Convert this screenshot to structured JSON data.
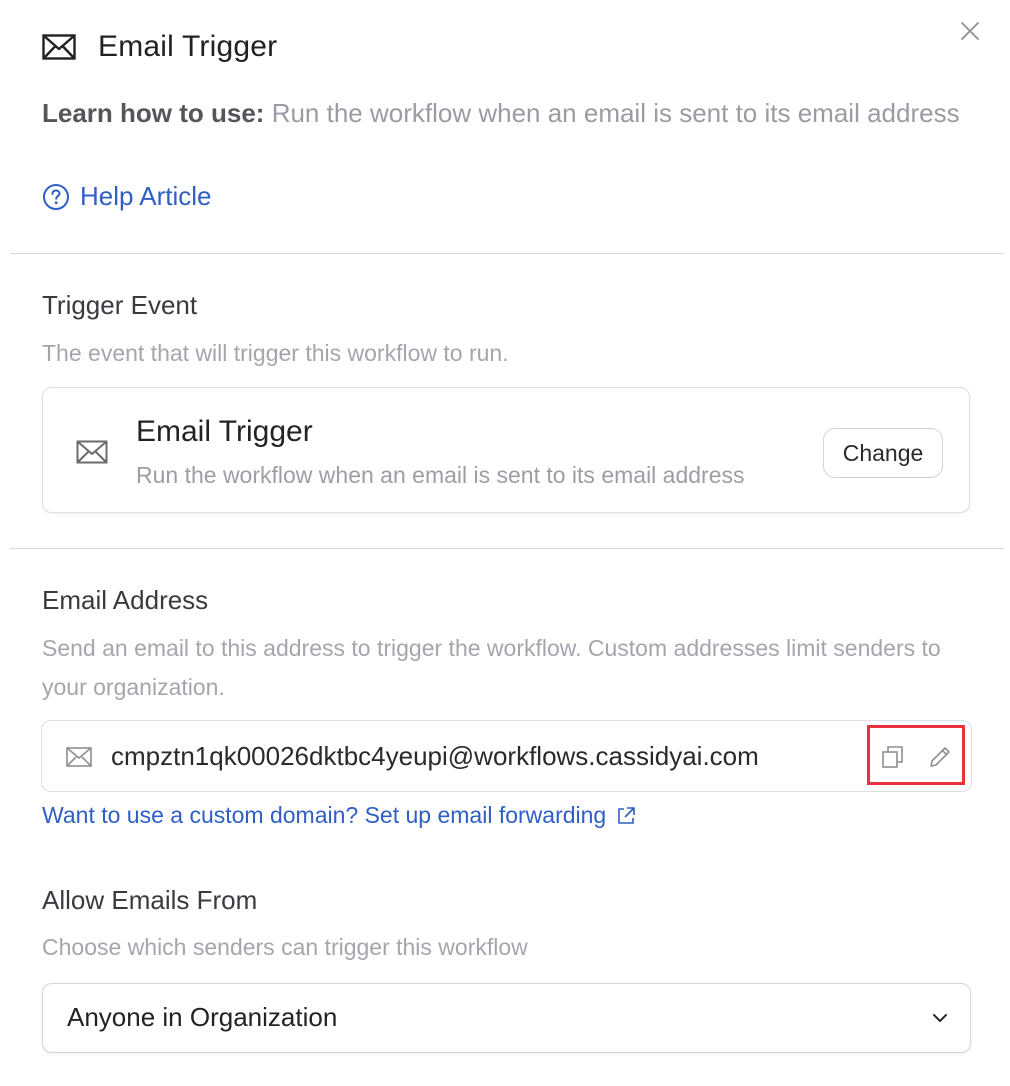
{
  "header": {
    "title": "Email Trigger",
    "icon": "envelope-icon",
    "close_icon": "close-icon"
  },
  "learn": {
    "label": "Learn how to use:",
    "text": " Run the workflow when an email is sent to its email address"
  },
  "help_link": {
    "label": "Help Article",
    "icon": "question-circle-icon"
  },
  "trigger_event": {
    "title": "Trigger Event",
    "description": "The event that will trigger this workflow to run.",
    "card": {
      "icon": "envelope-icon",
      "title": "Email Trigger",
      "description": "Run the workflow when an email is sent to its email address",
      "change_label": "Change"
    }
  },
  "email_address": {
    "title": "Email Address",
    "description": "Send an email to this address to trigger the workflow. Custom addresses limit senders to your organization.",
    "value": "cmpztn1qk00026dktbc4yeupi@workflows.cassidyai.com",
    "copy_icon": "copy-icon",
    "edit_icon": "pencil-icon",
    "forward_link": "Want to use a custom domain? Set up email forwarding",
    "forward_icon": "external-link-icon"
  },
  "allow_from": {
    "title": "Allow Emails From",
    "description": "Choose which senders can trigger this workflow",
    "selected": "Anyone in Organization",
    "chevron": "chevron-down-icon"
  },
  "colors": {
    "link": "#2f5fc4",
    "highlight": "#e8323e",
    "muted_text": "#a5a5ad"
  }
}
